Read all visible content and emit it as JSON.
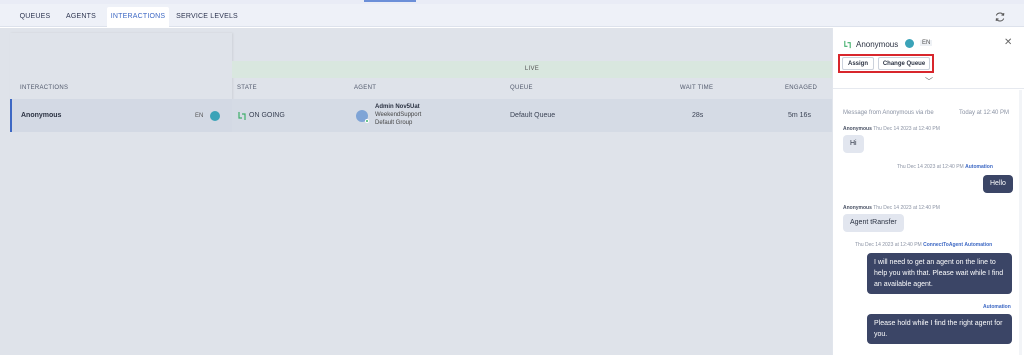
{
  "tabs": [
    "QUEUES",
    "AGENTS",
    "INTERACTIONS",
    "SERVICE LEVELS"
  ],
  "active_tab": "INTERACTIONS",
  "table": {
    "live_label": "LIVE",
    "headers": {
      "interactions": "INTERACTIONS",
      "state": "STATE",
      "agent": "AGENT",
      "queue": "QUEUE",
      "wait_time": "WAIT TIME",
      "engaged": "ENGAGED"
    },
    "row": {
      "name": "Anonymous",
      "lang": "EN",
      "state": "ON GOING",
      "agent_name": "Admin Nov5Uat",
      "agent_group1": "WeekendSupport",
      "agent_group2": "Default Group",
      "queue": "Default Queue",
      "wait_time": "28s",
      "engaged": "5m 16s"
    }
  },
  "side_panel": {
    "title": "Anonymous",
    "lang": "EN",
    "assign_label": "Assign",
    "change_queue_label": "Change Queue",
    "intro": "Message from Anonymous via rbe",
    "intro_time": "Today at 12:40 PM",
    "messages": [
      {
        "sender": "Anonymous",
        "time": "Thu Dec 14 2023 at 12:40 PM",
        "text": "Hi"
      },
      {
        "time": "Thu Dec 14 2023 at 12:40 PM",
        "tag": "Automation",
        "text": "Hello"
      },
      {
        "sender": "Anonymous",
        "time": "Thu Dec 14 2023 at 12:40 PM",
        "text": "Agent tRansfer"
      },
      {
        "time": "Thu Dec 14 2023 at 12:40 PM",
        "tag1": "ConnectToAgent",
        "tag": "Automation",
        "text": "I will need to get an agent on the line to help you with that. Please wait while I find an available agent."
      },
      {
        "tag": "Automation",
        "text": "Please hold while I find the right agent for you."
      }
    ]
  },
  "colors": {
    "accent": "#3d68c4",
    "highlight_box": "#d8262c",
    "outgoing_bubble": "#3b4566",
    "live_band": "#d9e7df"
  }
}
